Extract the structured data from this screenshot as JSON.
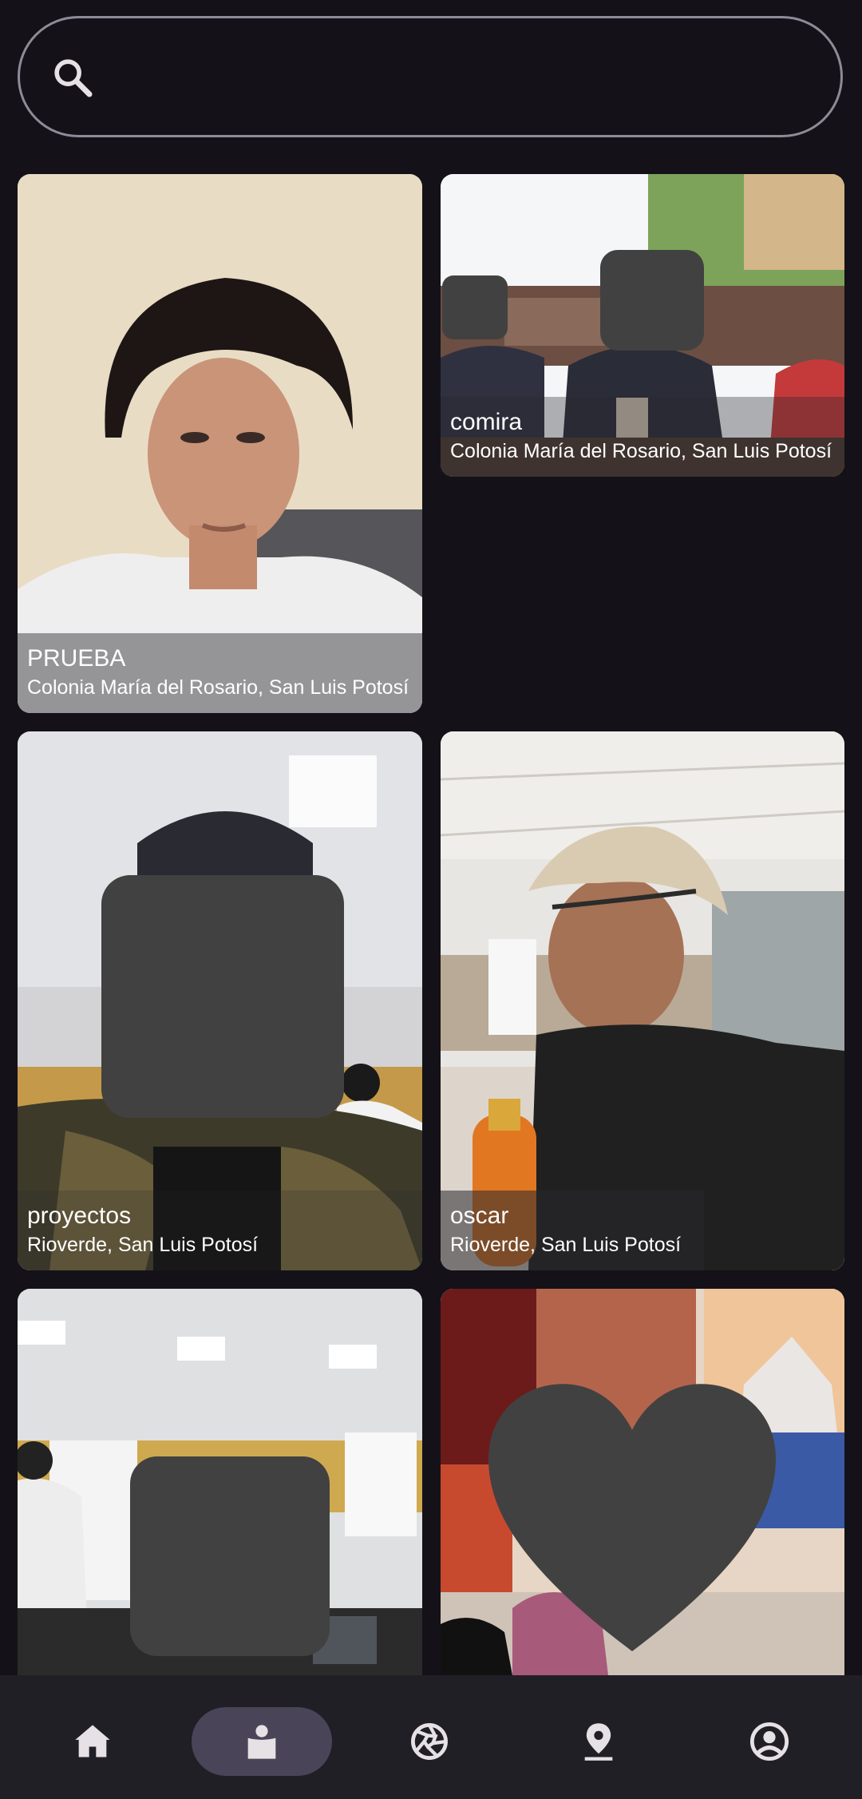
{
  "search": {
    "placeholder": "",
    "value": ""
  },
  "cards": [
    {
      "title": "PRUEBA",
      "location": "Colonia María del Rosario, San Luis Potosí"
    },
    {
      "title": "comira",
      "location": "Colonia María del Rosario, San Luis Potosí"
    },
    {
      "title": "proyectos",
      "location": "Rioverde, San Luis Potosí"
    },
    {
      "title": "oscar",
      "location": "Rioverde, San Luis Potosí"
    }
  ],
  "nav": [
    {
      "icon": "home-icon",
      "active": false
    },
    {
      "icon": "person-badge-icon",
      "active": true
    },
    {
      "icon": "camera-shutter-icon",
      "active": false
    },
    {
      "icon": "location-pin-icon",
      "active": false
    },
    {
      "icon": "account-circle-icon",
      "active": false
    }
  ],
  "colors": {
    "background": "#141218",
    "navbar": "#211f26",
    "nav_active": "#4a4458"
  }
}
